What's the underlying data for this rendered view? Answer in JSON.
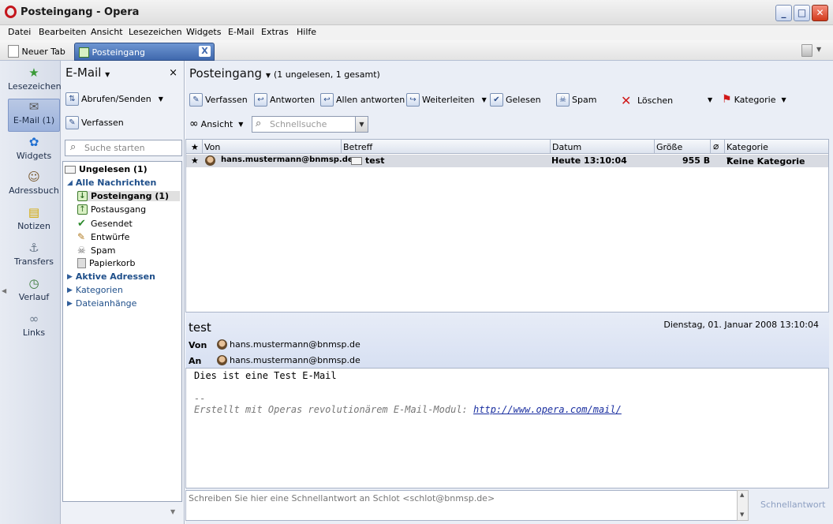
{
  "window": {
    "title": "Posteingang - Opera"
  },
  "menu": [
    "Datei",
    "Bearbeiten",
    "Ansicht",
    "Lesezeichen",
    "Widgets",
    "E-Mail",
    "Extras",
    "Hilfe"
  ],
  "tabs": {
    "new_tab": "Neuer Tab",
    "active": "Posteingang",
    "close": "X"
  },
  "sidebar": {
    "items": [
      "Lesezeichen",
      "E-Mail (1)",
      "Widgets",
      "Adressbuch",
      "Notizen",
      "Transfers",
      "Verlauf",
      "Links"
    ]
  },
  "panel": {
    "title": "E-Mail",
    "close": "×",
    "fetch_send": "Abrufen/Senden",
    "compose": "Verfassen",
    "search_placeholder": "Suche starten",
    "tree": {
      "unread": "Ungelesen (1)",
      "all_messages": "Alle Nachrichten",
      "inbox": "Posteingang (1)",
      "outbox": "Postausgang",
      "sent": "Gesendet",
      "drafts": "Entwürfe",
      "spam": "Spam",
      "trash": "Papierkorb",
      "active_contacts": "Aktive Adressen",
      "categories": "Kategorien",
      "attachments": "Dateianhänge"
    }
  },
  "main": {
    "title": "Posteingang",
    "status": "(1 ungelesen, 1 gesamt)",
    "toolbar": {
      "compose": "Verfassen",
      "reply": "Antworten",
      "reply_all": "Allen antworten",
      "forward": "Weiterleiten",
      "read": "Gelesen",
      "spam": "Spam",
      "delete": "Löschen",
      "category": "Kategorie",
      "view": "Ansicht",
      "quicksearch_placeholder": "Schnellsuche"
    },
    "columns": {
      "star": "★",
      "from": "Von",
      "subject": "Betreff",
      "date": "Datum",
      "size": "Größe",
      "category": "Kategorie"
    },
    "rows": [
      {
        "star": "★",
        "from": "hans.mustermann@bnmsp.de",
        "subject": "test",
        "date": "Heute 13:10:04",
        "size": "955 B",
        "category": "Keine Kategorie"
      }
    ],
    "preview": {
      "subject": "test",
      "date": "Dienstag, 01. Januar 2008 13:10:04",
      "from_label": "Von",
      "from": "hans.mustermann@bnmsp.de",
      "to_label": "An",
      "to": "hans.mustermann@bnmsp.de",
      "body_line1": "Dies ist eine Test E-Mail",
      "sig_dash": "--",
      "sig_text": "Erstellt mit Operas revolutionärem E-Mail-Modul: ",
      "sig_link": "http://www.opera.com/mail/"
    },
    "quick_reply": {
      "placeholder": "Schreiben Sie hier eine Schnellantwort an Schlot <schlot@bnmsp.de>",
      "button": "Schnellantwort"
    }
  }
}
